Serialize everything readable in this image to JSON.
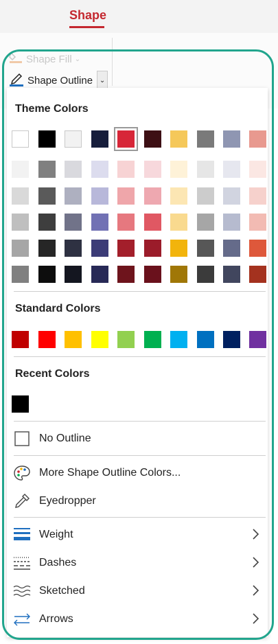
{
  "ribbon": {
    "tab_label": "Shape",
    "shape_fill_label": "Shape Fill",
    "shape_outline_label": "Shape Outline"
  },
  "dropdown": {
    "theme_colors_title": "Theme Colors",
    "theme_colors": [
      [
        "#FFFFFF",
        "#000000",
        "#F2F2F2",
        "#161D3B",
        "#D72638",
        "#3D0F14",
        "#F5C85A",
        "#7A7A7A",
        "#8F96B2",
        "#E8998F"
      ],
      [
        "#F2F2F2",
        "#808080",
        "#D9D9DE",
        "#DCDCEE",
        "#F7D3D4",
        "#F7D8DC",
        "#FEF2D8",
        "#E6E6E6",
        "#E6E7EF",
        "#FBE7E3"
      ],
      [
        "#D9D9D9",
        "#5A5A5A",
        "#AEB0C0",
        "#B8B8DA",
        "#EFA6AA",
        "#EEA8B0",
        "#FCE6B3",
        "#CCCCCC",
        "#D1D4E0",
        "#F6D1CC"
      ],
      [
        "#BFBFBF",
        "#3E3E3E",
        "#717389",
        "#7171B4",
        "#E6787F",
        "#E05863",
        "#F9DA8F",
        "#A6A6A6",
        "#B6BBCF",
        "#F2BBB3"
      ],
      [
        "#A6A6A6",
        "#262626",
        "#2E3142",
        "#3C3C77",
        "#A31F2B",
        "#9B1C2A",
        "#F2B40C",
        "#575757",
        "#656B8A",
        "#DE583B"
      ],
      [
        "#808080",
        "#0D0D0D",
        "#141620",
        "#272956",
        "#6E141C",
        "#6A111C",
        "#A07707",
        "#3B3B3B",
        "#41465E",
        "#A4321F"
      ]
    ],
    "standard_colors_title": "Standard Colors",
    "standard_colors": [
      "#C00000",
      "#FF0000",
      "#FFC000",
      "#FFFF00",
      "#92D050",
      "#00B050",
      "#00B0F0",
      "#0070C0",
      "#002060",
      "#7030A0"
    ],
    "recent_colors_title": "Recent Colors",
    "recent_colors": [
      "#000000"
    ],
    "selected_theme_color": "#D72638",
    "menu": {
      "no_outline": "No Outline",
      "more_colors": "More Shape Outline Colors...",
      "eyedropper": "Eyedropper",
      "weight": "Weight",
      "dashes": "Dashes",
      "sketched": "Sketched",
      "arrows": "Arrows"
    }
  },
  "accent_colors": {
    "brand": "#C4282F",
    "highlight": "#21A58D",
    "menu_icon": "#1F6FBF"
  }
}
